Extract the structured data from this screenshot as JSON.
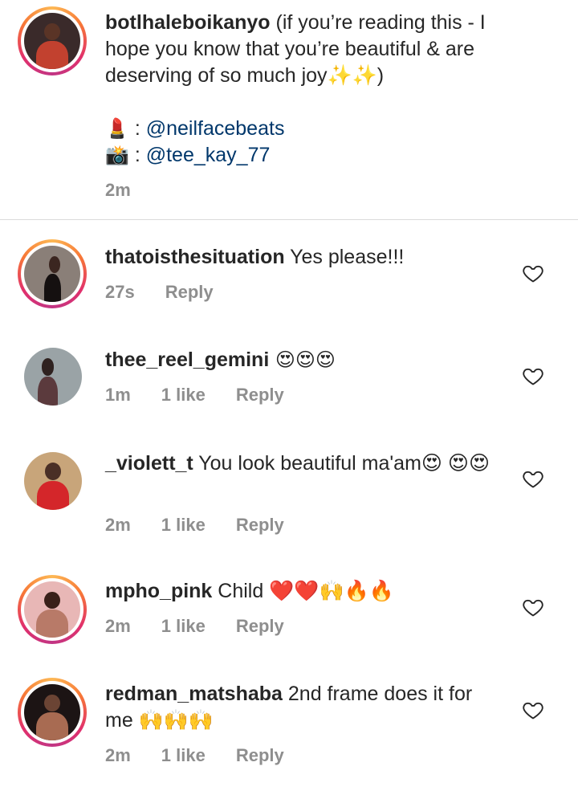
{
  "caption": {
    "username": "botlhaleboikanyo",
    "text": " (if you’re reading this - I hope you know that you’re beautiful & are deserving of so much joy✨✨)",
    "credit1_icon": "lipstick-icon",
    "credit1_sep": " : ",
    "credit1_handle": "@neilfacebeats",
    "credit2_icon": "camera-flash-icon",
    "credit2_sep": " : ",
    "credit2_handle": "@tee_kay_77",
    "time": "2m"
  },
  "comments": [
    {
      "username": "thatoisthesituation",
      "text": " Yes please!!!",
      "time": "27s",
      "likes": "",
      "reply": "Reply"
    },
    {
      "username": "thee_reel_gemini",
      "text": " 😍😍😍",
      "time": "1m",
      "likes": "1 like",
      "reply": "Reply"
    },
    {
      "username": "_violett_t",
      "text": " You look beautiful ma'am😍 😍😍",
      "time": "2m",
      "likes": "1 like",
      "reply": "Reply"
    },
    {
      "username": "mpho_pink",
      "text": " Child ❤️❤️🙌🔥🔥",
      "time": "2m",
      "likes": "1 like",
      "reply": "Reply"
    },
    {
      "username": "redman_matshaba",
      "text": " 2nd frame does it for me 🙌🙌🙌",
      "time": "2m",
      "likes": "1 like",
      "reply": "Reply"
    }
  ],
  "colors": {
    "text": "#262626",
    "meta": "#8e8e8e",
    "mention": "#00376b",
    "ring_start": "#fdb854",
    "ring_end": "#c13584"
  }
}
